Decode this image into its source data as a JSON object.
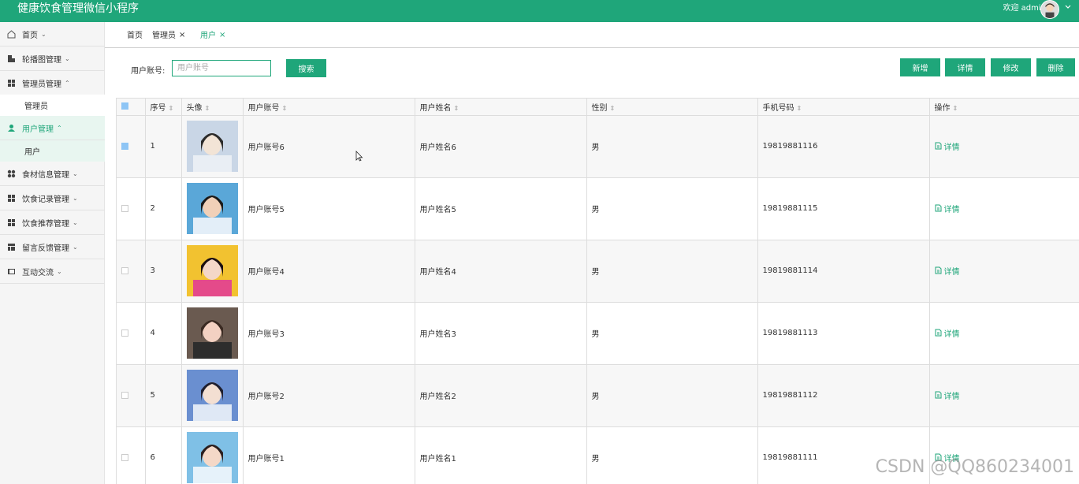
{
  "header": {
    "title": "健康饮食管理微信小程序",
    "welcome": "欢迎 admin"
  },
  "sidebar": {
    "items": [
      {
        "label": "首页",
        "icon": "home-icon"
      },
      {
        "label": "轮播图管理",
        "icon": "image-icon"
      },
      {
        "label": "管理员管理",
        "icon": "grid-icon"
      },
      {
        "label": "用户管理",
        "icon": "user-icon"
      },
      {
        "label": "食材信息管理",
        "icon": "apps-icon"
      },
      {
        "label": "饮食记录管理",
        "icon": "grid-icon"
      },
      {
        "label": "饮食推荐管理",
        "icon": "grid-icon"
      },
      {
        "label": "留言反馈管理",
        "icon": "table-icon"
      },
      {
        "label": "互动交流",
        "icon": "book-icon"
      }
    ],
    "subitems": {
      "admin": "管理员",
      "user": "用户"
    }
  },
  "tabs": [
    {
      "label": "首页"
    },
    {
      "label": "管理员"
    },
    {
      "label": "用户"
    }
  ],
  "search": {
    "label": "用户账号:",
    "placeholder": "用户账号",
    "button": "搜索"
  },
  "actions": {
    "add": "新增",
    "detail": "详情",
    "edit": "修改",
    "delete": "删除"
  },
  "table": {
    "columns": [
      "序号",
      "头像",
      "用户账号",
      "用户姓名",
      "性别",
      "手机号码",
      "操作"
    ],
    "rows": [
      {
        "index": "1",
        "account": "用户账号6",
        "name": "用户姓名6",
        "gender": "男",
        "phone": "19819881116",
        "op": "详情",
        "checked": true
      },
      {
        "index": "2",
        "account": "用户账号5",
        "name": "用户姓名5",
        "gender": "男",
        "phone": "19819881115",
        "op": "详情",
        "checked": false
      },
      {
        "index": "3",
        "account": "用户账号4",
        "name": "用户姓名4",
        "gender": "男",
        "phone": "19819881114",
        "op": "详情",
        "checked": false
      },
      {
        "index": "4",
        "account": "用户账号3",
        "name": "用户姓名3",
        "gender": "男",
        "phone": "19819881113",
        "op": "详情",
        "checked": false
      },
      {
        "index": "5",
        "account": "用户账号2",
        "name": "用户姓名2",
        "gender": "男",
        "phone": "19819881112",
        "op": "详情",
        "checked": false
      },
      {
        "index": "6",
        "account": "用户账号1",
        "name": "用户姓名1",
        "gender": "男",
        "phone": "19819881111",
        "op": "详情",
        "checked": false
      }
    ]
  },
  "watermark": "CSDN @QQ860234001",
  "colors": {
    "primary": "#1fa67a",
    "active_bg": "#e8f6f0"
  }
}
